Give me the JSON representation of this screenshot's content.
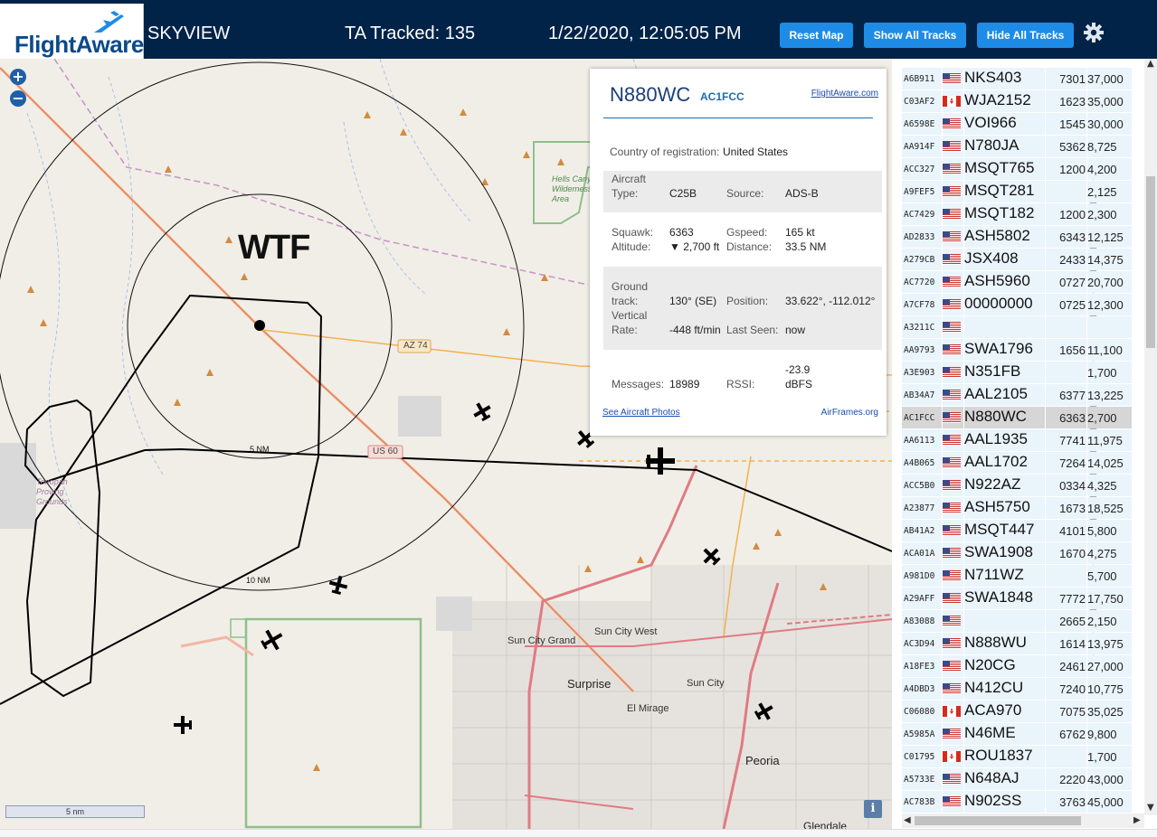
{
  "header": {
    "logo_text": "FlightAware",
    "app_title": "SKYVIEW",
    "tracked": "TA Tracked: 135",
    "datetime": "1/22/2020, 12:05:05 PM",
    "buttons": [
      "Reset Map",
      "Show All Tracks",
      "Hide All Tracks"
    ],
    "settings_icon": "gear-icon"
  },
  "map": {
    "zoom_in": "+",
    "zoom_out": "−",
    "annotation": "WTF",
    "range_labels": [
      "5 NM",
      "10 NM"
    ],
    "scale_label": "5 nm",
    "info_label": "i",
    "place_labels": [
      "Sun City Grand",
      "Sun City West",
      "Surprise",
      "Sun City",
      "El Mirage",
      "Peoria",
      "Glendale",
      "Hells Canyon Wilderness Area",
      "Tonopah Proving Grounds"
    ],
    "road_labels": [
      "AZ 74",
      "US 60"
    ],
    "colors": {
      "background": "#f1eee8",
      "range_ring": "#111111",
      "track": "#000000",
      "road_primary": "#e07b83",
      "road_secondary": "#f2b14d"
    }
  },
  "popup": {
    "ident": "N880WC",
    "hex": "AC1FCC",
    "fa_link": "FlightAware.com",
    "country_label": "Country of registration:",
    "country": "United States",
    "aircraft_type_label1": "Aircraft",
    "aircraft_type_label2": "Type:",
    "aircraft_type": "C25B",
    "source_label": "Source:",
    "source": "ADS-B",
    "squawk_label": "Squawk:",
    "squawk": "6363",
    "gspeed_label": "Gspeed:",
    "gspeed": "165 kt",
    "altitude_label": "Altitude:",
    "altitude": "▼ 2,700 ft",
    "distance_label": "Distance:",
    "distance": "33.5 NM",
    "ground_track_label1": "Ground",
    "ground_track_label2": "track:",
    "ground_track": "130° (SE)",
    "position_label": "Position:",
    "position": "33.622°, -112.012°",
    "vertical_label1": "Vertical",
    "vertical_label2": "Rate:",
    "vertical_rate": "-448 ft/min",
    "last_seen_label": "Last Seen:",
    "last_seen": "now",
    "messages_label": "Messages:",
    "messages": "18989",
    "rssi_label": "RSSI:",
    "rssi_value": "-23.9",
    "rssi_unit": "dBFS",
    "photos_link": "See Aircraft Photos",
    "airframes_link": "AirFrames.org"
  },
  "table": {
    "rows": [
      {
        "hex": "A6B911",
        "flag": "us",
        "ident": "NKS403",
        "squawk": "7301",
        "alt": "37,000"
      },
      {
        "hex": "C03AF2",
        "flag": "ca",
        "ident": "WJA2152",
        "squawk": "1623",
        "alt": "35,000"
      },
      {
        "hex": "A6598E",
        "flag": "us",
        "ident": "VOI966",
        "squawk": "1545",
        "alt": "30,000"
      },
      {
        "hex": "AA914F",
        "flag": "us",
        "ident": "N780JA",
        "squawk": "5362",
        "alt": "8,725"
      },
      {
        "hex": "ACC327",
        "flag": "us",
        "ident": "MSQT765",
        "squawk": "1200",
        "alt": "4,200 ▲"
      },
      {
        "hex": "A9FEF5",
        "flag": "us",
        "ident": "MSQT281",
        "squawk": "",
        "alt": "2,125 ▼"
      },
      {
        "hex": "AC7429",
        "flag": "us",
        "ident": "MSQT182",
        "squawk": "1200",
        "alt": "2,300"
      },
      {
        "hex": "AD2833",
        "flag": "us",
        "ident": "ASH5802",
        "squawk": "6343",
        "alt": "12,125 ▼"
      },
      {
        "hex": "A279CB",
        "flag": "us",
        "ident": "JSX408",
        "squawk": "2433",
        "alt": "14,375 ▼"
      },
      {
        "hex": "AC7720",
        "flag": "us",
        "ident": "ASH5960",
        "squawk": "0727",
        "alt": "20,700 ▲"
      },
      {
        "hex": "A7CF78",
        "flag": "us",
        "ident": "00000000",
        "squawk": "0725",
        "alt": "12,300 ▼"
      },
      {
        "hex": "A3211C",
        "flag": "us",
        "ident": "",
        "squawk": "",
        "alt": ""
      },
      {
        "hex": "AA9793",
        "flag": "us",
        "ident": "SWA1796",
        "squawk": "1656",
        "alt": "11,100 ▲"
      },
      {
        "hex": "A3E903",
        "flag": "us",
        "ident": "N351FB",
        "squawk": "",
        "alt": "1,700"
      },
      {
        "hex": "AB34A7",
        "flag": "us",
        "ident": "AAL2105",
        "squawk": "6377",
        "alt": "13,225 ▼"
      },
      {
        "hex": "AC1FCC",
        "flag": "us",
        "ident": "N880WC",
        "squawk": "6363",
        "alt": "2,700 ▼",
        "selected": true
      },
      {
        "hex": "AA6113",
        "flag": "us",
        "ident": "AAL1935",
        "squawk": "7741",
        "alt": "11,975 ▼"
      },
      {
        "hex": "A4B065",
        "flag": "us",
        "ident": "AAL1702",
        "squawk": "7264",
        "alt": "14,025 ▼"
      },
      {
        "hex": "ACC5B0",
        "flag": "us",
        "ident": "N922AZ",
        "squawk": "0334",
        "alt": "4,325 ▼"
      },
      {
        "hex": "A23877",
        "flag": "us",
        "ident": "ASH5750",
        "squawk": "1673",
        "alt": "18,525 ▼"
      },
      {
        "hex": "AB41A2",
        "flag": "us",
        "ident": "MSQT447",
        "squawk": "4101",
        "alt": "5,800"
      },
      {
        "hex": "ACA01A",
        "flag": "us",
        "ident": "SWA1908",
        "squawk": "1670",
        "alt": "4,275 ▲"
      },
      {
        "hex": "A981D0",
        "flag": "us",
        "ident": "N711WZ",
        "squawk": "",
        "alt": "5,700"
      },
      {
        "hex": "A29AFF",
        "flag": "us",
        "ident": "SWA1848",
        "squawk": "7772",
        "alt": "17,750 ▼"
      },
      {
        "hex": "A83088",
        "flag": "us",
        "ident": "",
        "squawk": "2665",
        "alt": "2,150 ▲"
      },
      {
        "hex": "AC3D94",
        "flag": "us",
        "ident": "N888WU",
        "squawk": "1614",
        "alt": "13,975 ▲"
      },
      {
        "hex": "A18FE3",
        "flag": "us",
        "ident": "N20CG",
        "squawk": "2461",
        "alt": "27,000"
      },
      {
        "hex": "A4DBD3",
        "flag": "us",
        "ident": "N412CU",
        "squawk": "7240",
        "alt": "10,775"
      },
      {
        "hex": "C06080",
        "flag": "ca",
        "ident": "ACA970",
        "squawk": "7075",
        "alt": "35,025"
      },
      {
        "hex": "A5985A",
        "flag": "us",
        "ident": "N46ME",
        "squawk": "6762",
        "alt": "9,800"
      },
      {
        "hex": "C01795",
        "flag": "ca",
        "ident": "ROU1837",
        "squawk": "",
        "alt": "1,700"
      },
      {
        "hex": "A5733E",
        "flag": "us",
        "ident": "N648AJ",
        "squawk": "2220",
        "alt": "43,000"
      },
      {
        "hex": "AC783B",
        "flag": "us",
        "ident": "N902SS",
        "squawk": "3763",
        "alt": "45,000"
      }
    ]
  }
}
